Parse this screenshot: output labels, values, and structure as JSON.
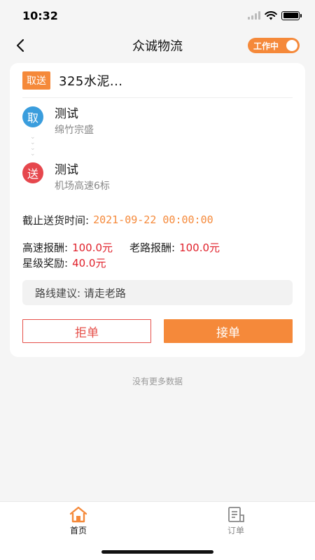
{
  "status_bar": {
    "time": "10:32"
  },
  "nav": {
    "title": "众诚物流",
    "toggle_label": "工作中"
  },
  "order": {
    "tag": "取送",
    "cargo_name": "325水泥...",
    "pickup": {
      "badge": "取",
      "name": "测试",
      "address": "绵竹宗盛"
    },
    "dropoff": {
      "badge": "送",
      "name": "测试",
      "address": "机场高速6标"
    },
    "deadline_label": "截止送货时间:",
    "deadline_value": "2021-09-22 00:00:00",
    "highway_pay_label": "高速报酬:",
    "highway_pay_value": "100.0元",
    "oldroad_pay_label": "老路报酬:",
    "oldroad_pay_value": "100.0元",
    "star_bonus_label": "星级奖励:",
    "star_bonus_value": "40.0元",
    "route_advice": "路线建议: 请走老路",
    "reject_label": "拒单",
    "accept_label": "接单"
  },
  "list_footer": "没有更多数据",
  "tabs": [
    {
      "label": "首页",
      "active": true
    },
    {
      "label": "订单",
      "active": false
    }
  ],
  "colors": {
    "accent": "#f5893a",
    "pickup": "#3a9ddd",
    "dropoff": "#e6474d",
    "money": "#e0202a"
  }
}
